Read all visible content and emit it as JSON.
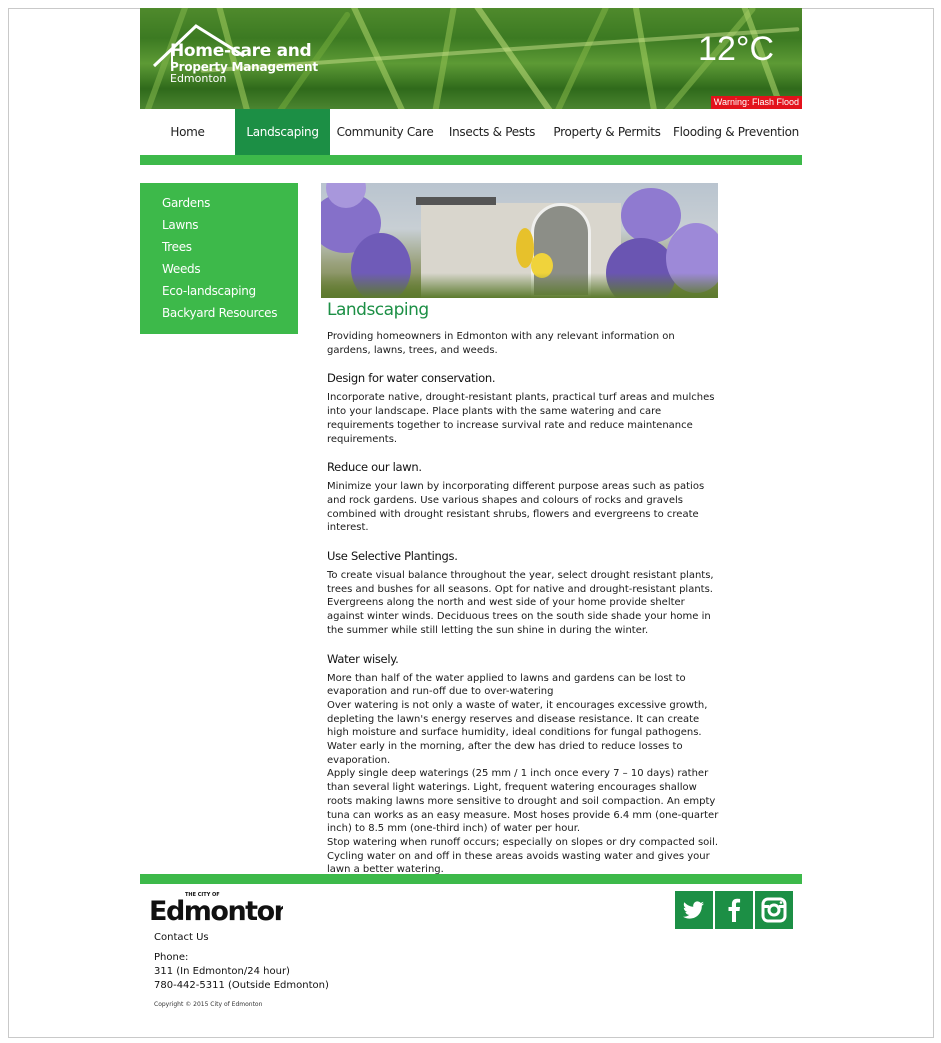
{
  "header": {
    "logo_line1": "Home-care and",
    "logo_line2": "Property Management",
    "logo_line3": "Edmonton",
    "temperature": "12°C",
    "warning": "Warning: Flash Flood"
  },
  "nav": {
    "items": [
      {
        "label": "Home"
      },
      {
        "label": "Landscaping",
        "active": true
      },
      {
        "label": "Community Care"
      },
      {
        "label": "Insects & Pests"
      },
      {
        "label": "Property & Permits"
      },
      {
        "label": "Flooding & Prevention"
      }
    ]
  },
  "sidebar": {
    "items": [
      {
        "label": "Gardens"
      },
      {
        "label": "Lawns"
      },
      {
        "label": "Trees"
      },
      {
        "label": "Weeds"
      },
      {
        "label": "Eco-landscaping"
      },
      {
        "label": "Backyard Resources"
      }
    ]
  },
  "content": {
    "title": "Landscaping",
    "intro": "Providing homeowners in Edmonton with any relevant information on gardens, lawns, trees, and weeds.",
    "sections": [
      {
        "heading": "Design for water conservation.",
        "body": "Incorporate native, drought-resistant plants, practical turf areas and mulches into your landscape. Place plants with the same watering and care requirements together to increase survival rate and reduce maintenance requirements."
      },
      {
        "heading": "Reduce our lawn.",
        "body": "Minimize your lawn by incorporating different purpose areas such as patios and rock gardens. Use various shapes and colours of rocks and gravels combined with drought resistant shrubs, flowers and evergreens to create interest."
      },
      {
        "heading": "Use Selective Plantings.",
        "body": "To create visual balance throughout the year, select drought resistant plants, trees and bushes for all seasons. Opt for native and drought-resistant plants. Evergreens along the north and west side of your home provide shelter against winter winds. Deciduous trees on the south side shade your home in the summer while still letting the sun shine in during the winter."
      },
      {
        "heading": "Water wisely.",
        "paragraphs": [
          "More than half of the water applied to lawns and gardens can be lost to evaporation and run-off due to over-watering",
          "Over watering is not only a waste of water, it encourages excessive growth, depleting the lawn's energy reserves and disease resistance. It can create high moisture and surface humidity, ideal conditions for fungal pathogens.",
          "Water early in the morning, after the dew has dried to reduce losses to evaporation.",
          "Apply single deep waterings (25 mm / 1 inch once every 7 – 10 days) rather than several light waterings. Light, frequent watering encourages shallow roots making lawns more sensitive to drought and soil compaction. An empty tuna can works as an easy measure. Most hoses provide 6.4 mm (one-quarter inch) to 8.5 mm (one-third inch) of water per hour.",
          "Stop watering when runoff occurs; especially on slopes or dry compacted soil. Cycling water on and off in these areas avoids wasting water and gives your lawn a better watering."
        ]
      }
    ]
  },
  "footer": {
    "logo_small": "THE CITY OF",
    "logo_text": "Edmonton",
    "contact": "Contact Us",
    "phone_label": "Phone:",
    "phone_1": "311 (In Edmonton/24 hour)",
    "phone_2": "780-442-5311 (Outside Edmonton)",
    "copyright": "Copyright © 2015 City of Edmonton",
    "social": [
      "twitter-icon",
      "facebook-icon",
      "instagram-icon"
    ]
  },
  "colors": {
    "brand_green": "#3db94a",
    "dark_green": "#1c8f45",
    "warning_red": "#e3121b"
  }
}
